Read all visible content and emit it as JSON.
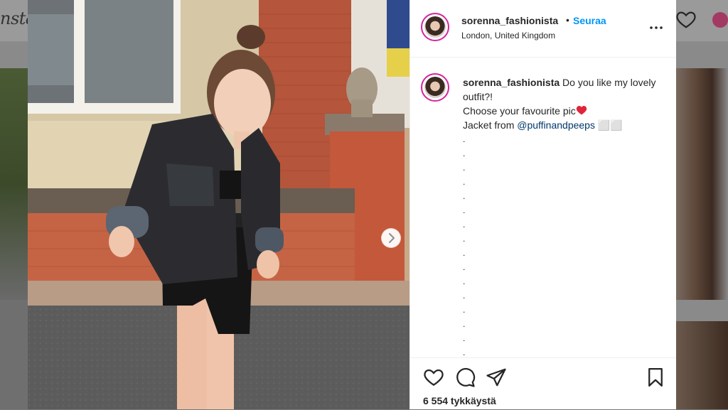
{
  "background": {
    "logo_text": "nsta",
    "accent_avatar_color": "#a23a63"
  },
  "post": {
    "username": "sorenna_fashionista",
    "separator": "•",
    "follow_label": "Seuraa",
    "location": "London, United Kingdom",
    "caption": {
      "username": "sorenna_fashionista",
      "line1": " Do you like my lovely outfit?!",
      "line2": "Choose your favourite pic",
      "line3_prefix": "Jacket from ",
      "mention": "@puffinandpeeps",
      "line3_suffix": " ⬜⬜",
      "dots": [
        ".",
        ".",
        ".",
        ".",
        ".",
        ".",
        ".",
        ".",
        ".",
        ".",
        ".",
        ".",
        ".",
        ".",
        ".",
        "."
      ]
    },
    "likes": "6 554 tykkäystä"
  },
  "icons": {
    "more": "more-options-icon",
    "like": "heart-icon",
    "comment": "comment-icon",
    "share": "paper-plane-icon",
    "save": "bookmark-icon",
    "next": "chevron-right-icon"
  },
  "colors": {
    "follow": "#0095f6",
    "mention": "#00376b",
    "heart_emoji": "#e0243b",
    "story_ring": "#d6249f"
  }
}
